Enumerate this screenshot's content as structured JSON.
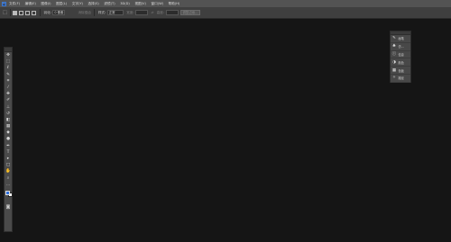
{
  "menubar": {
    "logo": "Ps",
    "items": [
      "文件(F)",
      "编辑(E)",
      "图像(I)",
      "图层(L)",
      "文字(Y)",
      "选择(S)",
      "滤镜(T)",
      "3D(D)",
      "视图(V)",
      "窗口(W)",
      "帮助(H)"
    ]
  },
  "options": {
    "feather_label": "羽化:",
    "feather_value": "0 像素",
    "antialias_label": "消除锯齿",
    "style_label": "样式:",
    "style_value": "正常",
    "width_label": "宽度:",
    "height_label": "高度:",
    "refine_edge_label": "调整边缘..."
  },
  "toolbar": {
    "icons": [
      "move-icon",
      "marquee-icon",
      "lasso-icon",
      "quick-select-icon",
      "crop-icon",
      "eyedropper-icon",
      "healing-brush-icon",
      "brush-icon",
      "clone-stamp-icon",
      "history-brush-icon",
      "eraser-icon",
      "gradient-icon",
      "blur-icon",
      "dodge-icon",
      "pen-icon",
      "type-icon",
      "path-select-icon",
      "shape-icon",
      "hand-icon",
      "zoom-icon",
      "ellipsis-icon"
    ],
    "glyphs": [
      "✥",
      "⬚",
      "ℓ",
      "✎",
      "⌗",
      "⁄",
      "✚",
      "✐",
      "⊥",
      "↺",
      "◧",
      "▦",
      "◆",
      "●",
      "✒",
      "T",
      "▸",
      "□",
      "✋",
      "⌕",
      "…"
    ],
    "quickmask_glyph": "◙",
    "foreground_color": "#2f6fdc",
    "background_color": "#ffffff"
  },
  "panel": {
    "items": [
      {
        "icon": "brush-preset-icon",
        "glyph": "✎",
        "label": "画笔"
      },
      {
        "icon": "clone-source-icon",
        "glyph": "♣",
        "label": "仿..."
      },
      {
        "icon": "info-icon",
        "glyph": "ⓘ",
        "label": "信息"
      },
      {
        "icon": "color-icon",
        "glyph": "◑",
        "label": "颜色"
      },
      {
        "icon": "swatches-icon",
        "glyph": "▦",
        "label": "色板"
      },
      {
        "icon": "paths-icon",
        "glyph": "✧",
        "label": "路径"
      }
    ]
  }
}
